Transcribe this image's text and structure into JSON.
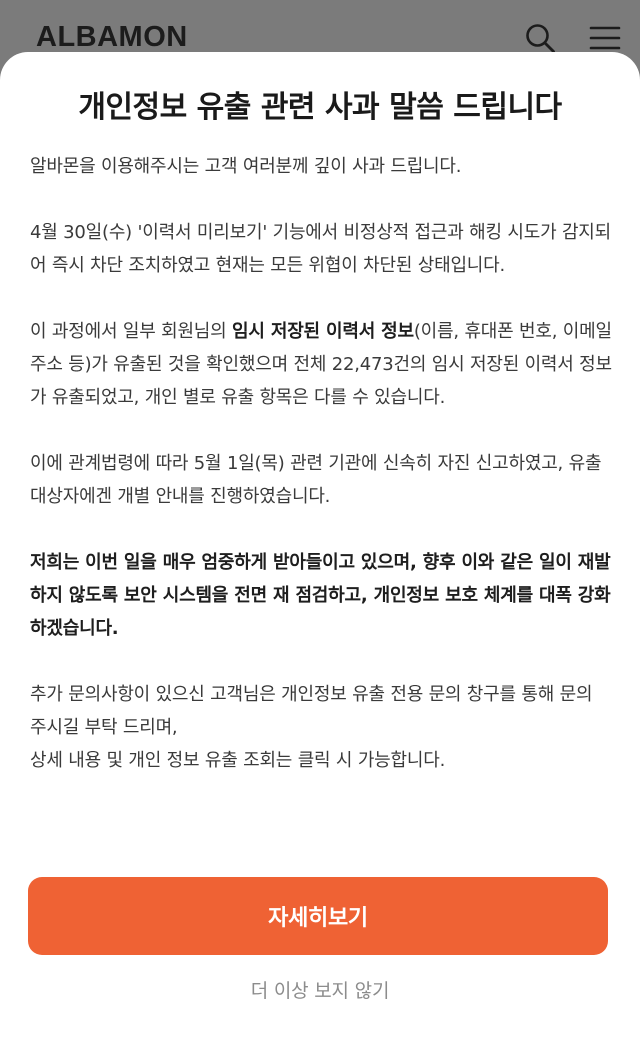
{
  "header": {
    "logo": "ALBAMON",
    "search_icon": "search-icon",
    "menu_icon": "menu-icon"
  },
  "modal": {
    "title": "개인정보 유출 관련 사과 말씀 드립니다",
    "p1": "알바몬을 이용해주시는 고객 여러분께 깊이 사과 드립니다.",
    "p2": "4월 30일(수) '이력서 미리보기' 기능에서 비정상적 접근과 해킹 시도가 감지되어 즉시 차단 조치하였고 현재는 모든 위협이 차단된 상태입니다.",
    "p3_before": "이 과정에서 일부 회원님의 ",
    "p3_bold": "임시 저장된 이력서 정보",
    "p3_after": "(이름, 휴대폰 번호, 이메일 주소 등)가 유출된 것을 확인했으며 전체 22,473건의 임시 저장된 이력서 정보가 유출되었고, 개인 별로 유출 항목은 다를 수 있습니다.",
    "p4": "이에 관계법령에 따라 5월 1일(목) 관련 기관에 신속히 자진 신고하였고, 유출 대상자에겐 개별 안내를 진행하였습니다.",
    "p5": "저희는 이번 일을 매우 엄중하게 받아들이고 있으며, 향후 이와 같은 일이 재발하지 않도록 보안 시스템을 전면 재 점검하고, 개인정보 보호 체계를 대폭 강화하겠습니다.",
    "p6_line1": "추가 문의사항이 있으신 고객님은 개인정보 유출 전용 문의 창구를 통해 문의 주시길 부탁 드리며,",
    "p6_line2": "상세 내용 및 개인 정보 유출 조회는 클릭 시 가능합니다.",
    "detail_button": "자세히보기",
    "dismiss_link": "더 이상 보지 않기"
  },
  "colors": {
    "accent": "#ef6234",
    "overlay": "#7b7b7b",
    "text": "#3a3a3a"
  }
}
